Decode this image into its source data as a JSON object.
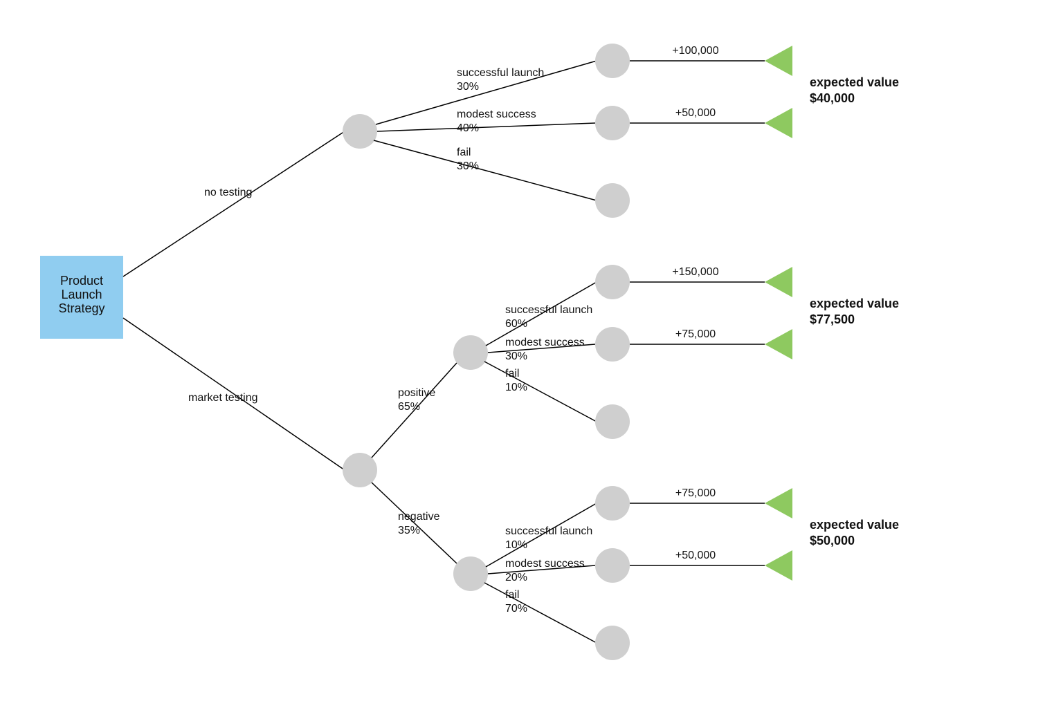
{
  "chart_data": {
    "type": "decision-tree",
    "root": "Product Launch Strategy",
    "branches": [
      {
        "decision": "no testing",
        "outcomes": [
          {
            "label": "successful launch",
            "probability": 0.3,
            "payoff": 100000
          },
          {
            "label": "modest success",
            "probability": 0.4,
            "payoff": 50000
          },
          {
            "label": "fail",
            "probability": 0.3,
            "payoff": 0
          }
        ],
        "expected_value": 40000
      },
      {
        "decision": "market testing",
        "sub": [
          {
            "result": "positive",
            "probability": 0.65,
            "outcomes": [
              {
                "label": "successful launch",
                "probability": 0.6,
                "payoff": 150000
              },
              {
                "label": "modest success",
                "probability": 0.3,
                "payoff": 75000
              },
              {
                "label": "fail",
                "probability": 0.1,
                "payoff": 0
              }
            ],
            "expected_value": 77500
          },
          {
            "result": "negative",
            "probability": 0.35,
            "outcomes": [
              {
                "label": "successful launch",
                "probability": 0.1,
                "payoff": 75000
              },
              {
                "label": "modest success",
                "probability": 0.2,
                "payoff": 50000
              },
              {
                "label": "fail",
                "probability": 0.7,
                "payoff": 0
              }
            ],
            "expected_value": 50000
          }
        ]
      }
    ]
  },
  "root": {
    "line1": "Product",
    "line2": "Launch",
    "line3": "Strategy"
  },
  "dec": {
    "no_testing": "no testing",
    "market_testing": "market testing"
  },
  "test": {
    "positive_label": "positive",
    "positive_pct": "65%",
    "negative_label": "negative",
    "negative_pct": "35%"
  },
  "nt": {
    "o1_label": "successful launch",
    "o1_pct": "30%",
    "o1_payoff": "+100,000",
    "o2_label": "modest success",
    "o2_pct": "40%",
    "o2_payoff": "+50,000",
    "o3_label": "fail",
    "o3_pct": "30%"
  },
  "pos": {
    "o1_label": "successful launch",
    "o1_pct": "60%",
    "o1_payoff": "+150,000",
    "o2_label": "modest success",
    "o2_pct": "30%",
    "o2_payoff": "+75,000",
    "o3_label": "fail",
    "o3_pct": "10%"
  },
  "neg": {
    "o1_label": "successful launch",
    "o1_pct": "10%",
    "o1_payoff": "+75,000",
    "o2_label": "modest success",
    "o2_pct": "20%",
    "o2_payoff": "+50,000",
    "o3_label": "fail",
    "o3_pct": "70%"
  },
  "ev": {
    "title": "expected value",
    "nt_val": "$40,000",
    "pos_val": "$77,500",
    "neg_val": "$50,000"
  },
  "colors": {
    "root_fill": "#90cdf0",
    "node_fill": "#cfcfcf",
    "terminal_fill": "#8ec960",
    "edge": "#000000"
  }
}
